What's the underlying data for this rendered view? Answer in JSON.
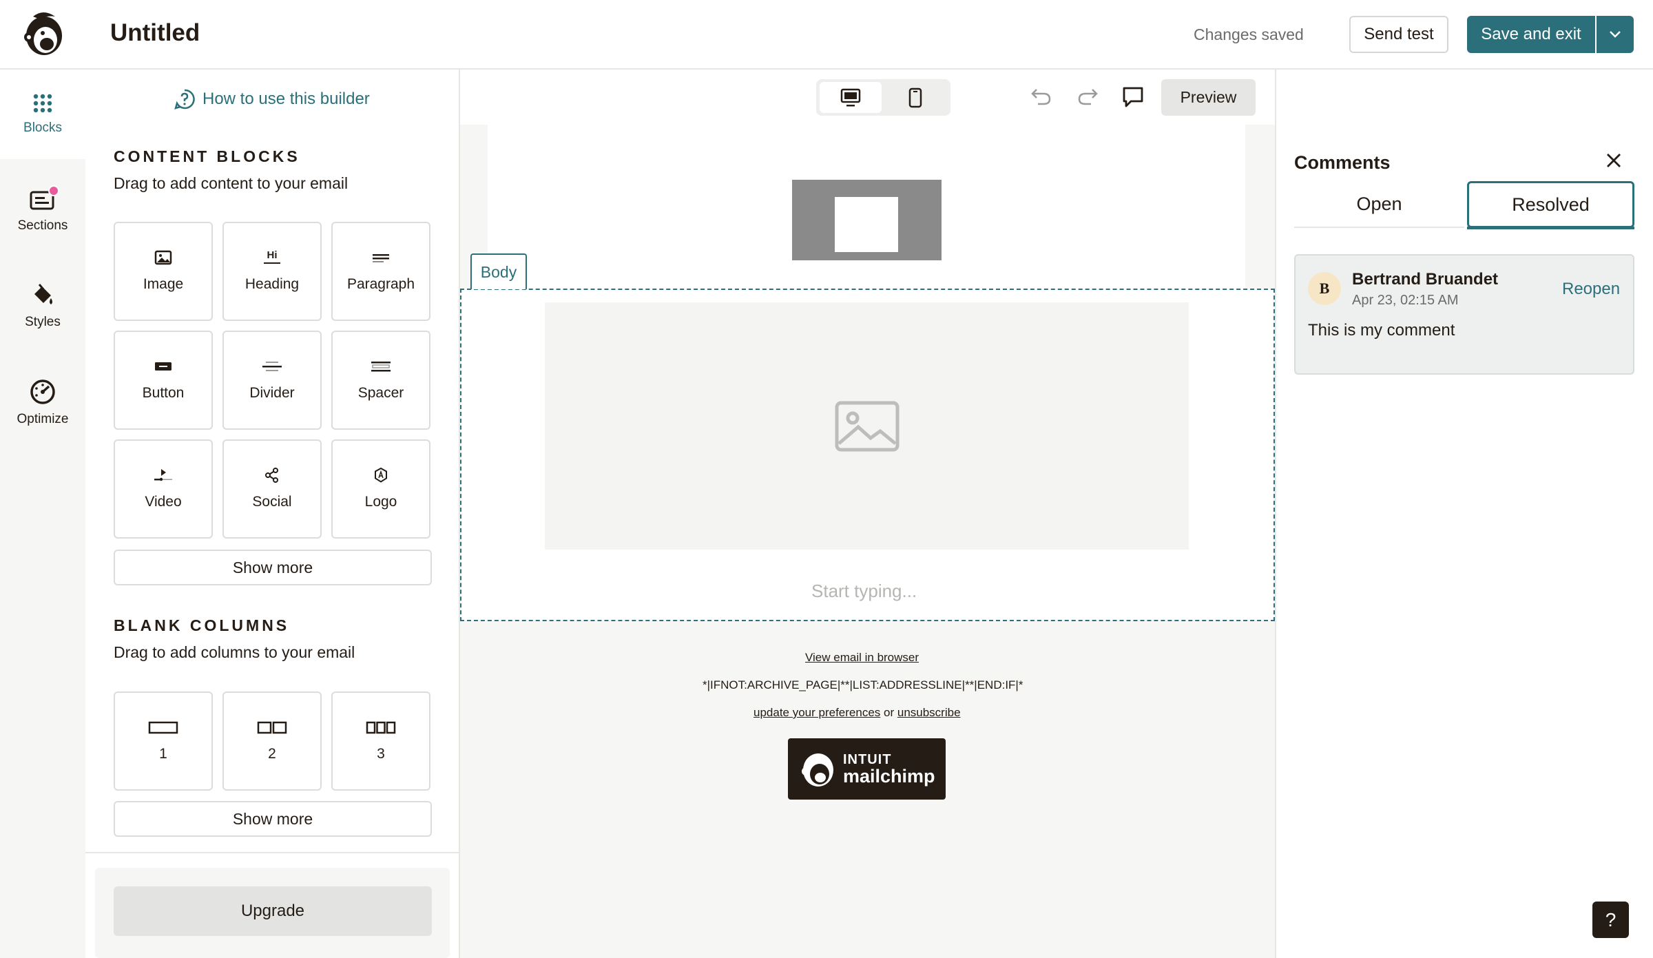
{
  "header": {
    "title": "Untitled",
    "status": "Changes saved",
    "send_test": "Send test",
    "save_exit": "Save and exit"
  },
  "rail": {
    "items": [
      {
        "label": "Blocks",
        "icon": "grid-dots-icon"
      },
      {
        "label": "Sections",
        "icon": "sections-icon"
      },
      {
        "label": "Styles",
        "icon": "paint-bucket-icon"
      },
      {
        "label": "Optimize",
        "icon": "gauge-icon"
      }
    ]
  },
  "blocks_panel": {
    "how_to": "How to use this builder",
    "content_title": "CONTENT BLOCKS",
    "content_sub": "Drag to add content to your email",
    "content_tiles": [
      {
        "label": "Image",
        "icon": "image-icon"
      },
      {
        "label": "Heading",
        "icon": "heading-icon",
        "glyph": "Hi"
      },
      {
        "label": "Paragraph",
        "icon": "paragraph-icon"
      },
      {
        "label": "Button",
        "icon": "button-icon"
      },
      {
        "label": "Divider",
        "icon": "divider-icon"
      },
      {
        "label": "Spacer",
        "icon": "spacer-icon"
      },
      {
        "label": "Video",
        "icon": "video-icon"
      },
      {
        "label": "Social",
        "icon": "social-icon"
      },
      {
        "label": "Logo",
        "icon": "logo-icon"
      }
    ],
    "show_more": "Show more",
    "columns_title": "BLANK COLUMNS",
    "columns_sub": "Drag to add columns to your email",
    "column_tiles": [
      {
        "label": "1",
        "icon": "one-column-icon"
      },
      {
        "label": "2",
        "icon": "two-column-icon"
      },
      {
        "label": "3",
        "icon": "three-column-icon"
      }
    ],
    "show_more_2": "Show more",
    "upgrade": "Upgrade"
  },
  "toolbar": {
    "preview": "Preview"
  },
  "canvas": {
    "body_tag": "Body",
    "start_typing": "Start typing...",
    "footer_view_browser": "View email in browser",
    "footer_merge": "*|IFNOT:ARCHIVE_PAGE|**|LIST:ADDRESSLINE|**|END:IF|*",
    "footer_update": "update your preferences",
    "footer_or": " or ",
    "footer_unsubscribe": "unsubscribe",
    "badge_line1": "INTUIT",
    "badge_line2": "mailchimp"
  },
  "comments": {
    "title": "Comments",
    "tab_open": "Open",
    "tab_resolved": "Resolved",
    "card": {
      "avatar_initial": "B",
      "author": "Bertrand Bruandet",
      "date": "Apr 23, 02:15 AM",
      "action": "Reopen",
      "text": "This is my comment"
    }
  },
  "help": "?",
  "colors": {
    "accent": "#2b6f7a",
    "text": "#241c15",
    "notification": "#e85c9b"
  }
}
